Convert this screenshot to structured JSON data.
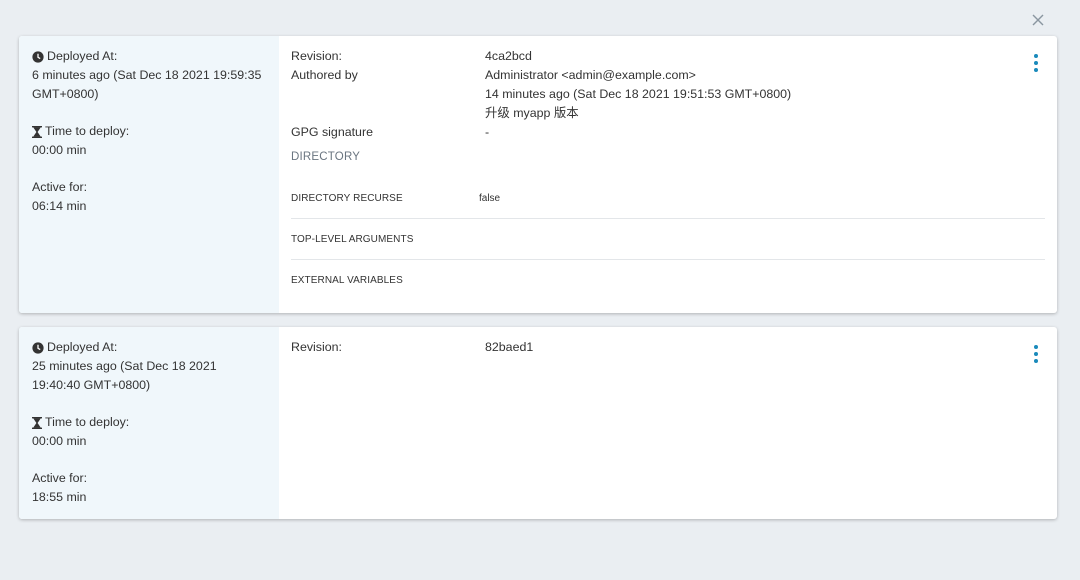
{
  "colors": {
    "background": "#eaeef2",
    "left_panel": "#f0f7fb",
    "accent": "#1a8abb",
    "section_title": "#6a7580"
  },
  "close_icon": "close-icon",
  "cards": [
    {
      "deployed_at_label": "Deployed At:",
      "deployed_at_value": "6 minutes ago (Sat Dec 18 2021 19:59:35 GMT+0800)",
      "time_to_deploy_label": "Time to deploy:",
      "time_to_deploy_value": "00:00 min",
      "active_for_label": "Active for:",
      "active_for_value": "06:14 min",
      "revision_label": "Revision:",
      "revision_value": "4ca2bcd",
      "authored_by_label": "Authored by",
      "author": "Administrator <admin@example.com>",
      "authored_time": "14 minutes ago (Sat Dec 18 2021 19:51:53 GMT+0800)",
      "commit_message": "升级 myapp 版本",
      "gpg_label": "GPG signature",
      "gpg_value": "-",
      "directory_title": "DIRECTORY",
      "params": [
        {
          "key": "DIRECTORY RECURSE",
          "value": "false"
        },
        {
          "key": "TOP-LEVEL ARGUMENTS",
          "value": ""
        },
        {
          "key": "EXTERNAL VARIABLES",
          "value": ""
        }
      ]
    },
    {
      "deployed_at_label": "Deployed At:",
      "deployed_at_value": "25 minutes ago (Sat Dec 18 2021 19:40:40 GMT+0800)",
      "time_to_deploy_label": "Time to deploy:",
      "time_to_deploy_value": "00:00 min",
      "active_for_label": "Active for:",
      "active_for_value": "18:55 min",
      "revision_label": "Revision:",
      "revision_value": "82baed1"
    }
  ]
}
